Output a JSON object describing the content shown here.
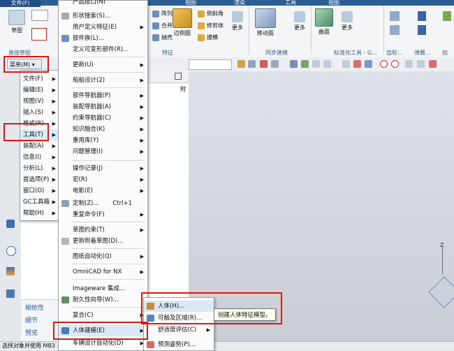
{
  "ribbon": {
    "file_label": "文件(F)",
    "top_tabs": [
      "视图",
      "渲染",
      "工具",
      "视图"
    ],
    "sketch_label": "草图",
    "group_direct_sketch": "直接草图",
    "feature_items": [
      "阵列特征",
      "合并",
      "抽壳"
    ],
    "group_feature": "特征",
    "edge_blend": "边倒圆",
    "chamfer": "倒斜角",
    "trim_body": "修剪体",
    "draft": "拔模",
    "more1": "更多",
    "move_face": "移动面",
    "more2": "更多",
    "group_sync": "同步建模",
    "surface": "曲面",
    "more3": "更多",
    "group_std": "标准化工具 - G...",
    "group_gear": "齿轮...",
    "group_spring": "弹簧...",
    "group_machining": "加工..."
  },
  "toolbar": {
    "menu_button": "菜单(M)"
  },
  "main_menu": [
    {
      "label": "文件(F)",
      "sub": true
    },
    {
      "label": "编辑(E)",
      "sub": true
    },
    {
      "label": "视图(V)",
      "sub": true
    },
    {
      "label": "插入(S)",
      "sub": true
    },
    {
      "label": "格式(R)",
      "sub": true
    },
    {
      "label": "工具(T)",
      "sub": true
    },
    {
      "label": "装配(A)",
      "sub": true
    },
    {
      "label": "信息(I)",
      "sub": true
    },
    {
      "label": "分析(L)",
      "sub": true
    },
    {
      "label": "首选项(P)",
      "sub": true
    },
    {
      "label": "窗口(O)",
      "sub": true
    },
    {
      "label": "GC工具箱",
      "sub": true
    },
    {
      "label": "帮助(H)",
      "sub": true
    }
  ],
  "tools_menu": {
    "top_item": "产品接口(N)",
    "items": [
      {
        "label": "形状搜索(S)..."
      },
      {
        "label": "用户定义特征(E)",
        "sub": true
      },
      {
        "label": "部件族(L)..."
      },
      {
        "label": "定义可变形部件(R)..."
      },
      {
        "label": "更新(U)",
        "sub": true
      },
      {
        "label": "船舶设计(2)",
        "sub": true
      },
      {
        "label": "部件导航器(P)",
        "sub": true
      },
      {
        "label": "装配导航器(A)",
        "sub": true
      },
      {
        "label": "约束导航器(C)",
        "sub": true
      },
      {
        "label": "知识融合(K)",
        "sub": true
      },
      {
        "label": "重用库(Y)",
        "sub": true
      },
      {
        "label": "问题管理(I)",
        "sub": true
      },
      {
        "label": "操作记录(J)",
        "sub": true
      },
      {
        "label": "宏(R)",
        "sub": true
      },
      {
        "label": "电影(E)",
        "sub": true
      },
      {
        "label": "定制(Z)...",
        "shortcut": "Ctrl+1"
      },
      {
        "label": "重复命令(F)",
        "sub": true
      },
      {
        "label": "草图约束(T)",
        "sub": true
      },
      {
        "label": "更新附着草图(D)..."
      },
      {
        "label": "图纸自动化(Q)",
        "sub": true
      },
      {
        "label": "OmniCAD for NX",
        "sub": true
      },
      {
        "label": "Imageware 集成..."
      },
      {
        "label": "耐久性向导(W)..."
      },
      {
        "label": "复合(C)",
        "sub": true
      },
      {
        "label": "人体建模(E)",
        "sub": true
      },
      {
        "label": "车辆设计自动化(D)",
        "sub": true
      }
    ]
  },
  "human_menu": [
    {
      "label": "人体(H)..."
    },
    {
      "label": "可触及区域(R)..."
    },
    {
      "label": "舒适度评估(C)",
      "sub": true
    },
    {
      "label": "预测姿势(P)..."
    }
  ],
  "tooltip": "创建人体特征模型。",
  "nav_panel": {
    "col_header": "附",
    "rows": [
      "相依性",
      "细节",
      "预览"
    ]
  },
  "status": "选择对象并使用 MB3",
  "axis_label": "Z"
}
